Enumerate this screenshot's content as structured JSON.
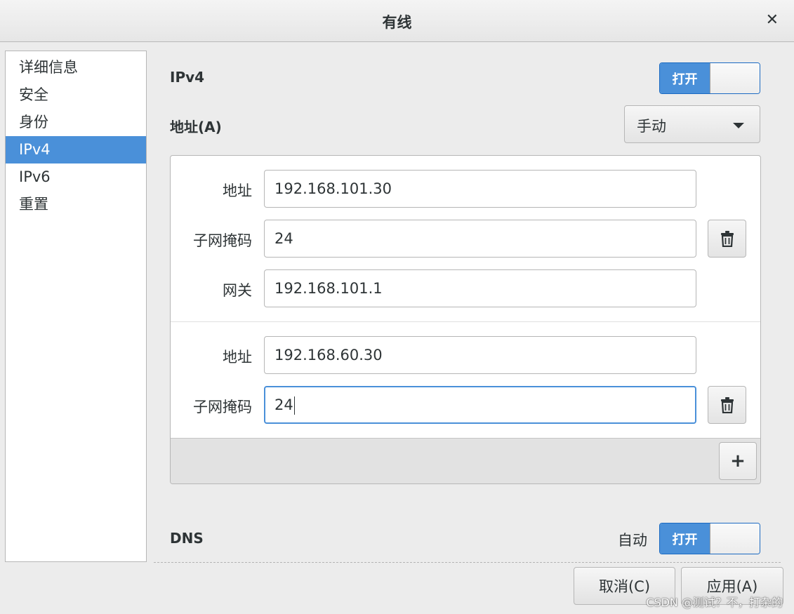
{
  "window": {
    "title": "有线"
  },
  "sidebar": {
    "items": [
      {
        "label": "详细信息",
        "active": false
      },
      {
        "label": "安全",
        "active": false
      },
      {
        "label": "身份",
        "active": false
      },
      {
        "label": "IPv4",
        "active": true
      },
      {
        "label": "IPv6",
        "active": false
      },
      {
        "label": "重置",
        "active": false
      }
    ]
  },
  "ipv4": {
    "heading": "IPv4",
    "toggle_label": "打开",
    "toggle_on": true,
    "address_heading": "地址(A)",
    "method": "手动"
  },
  "addresses": [
    {
      "address_label": "地址",
      "address": "192.168.101.30",
      "netmask_label": "子网掩码",
      "netmask": "24",
      "gateway_label": "网关",
      "gateway": "192.168.101.1"
    },
    {
      "address_label": "地址",
      "address": "192.168.60.30",
      "netmask_label": "子网掩码",
      "netmask": "24"
    }
  ],
  "add_button": "+",
  "dns": {
    "heading": "DNS",
    "auto_label": "自动",
    "toggle_label": "打开",
    "toggle_on": true
  },
  "buttons": {
    "cancel": "取消(C)",
    "apply": "应用(A)"
  },
  "watermark": "CSDN @测试？不，打杂的",
  "icons": {
    "close": "close-icon",
    "delete": "trash-icon",
    "dropdown": "chevron-down-icon",
    "add": "plus-icon"
  },
  "colors": {
    "accent": "#4a90d9",
    "focus": "#4a90d9"
  }
}
